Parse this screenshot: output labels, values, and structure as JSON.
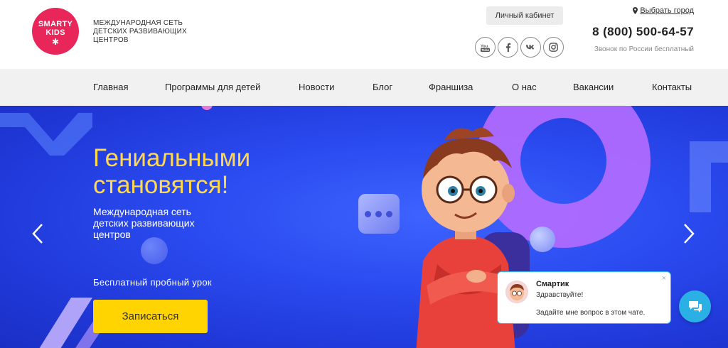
{
  "header": {
    "logo_line1": "SMARTY",
    "logo_line2": "KIDS",
    "tagline": "МЕЖДУНАРОДНАЯ СЕТЬ ДЕТСКИХ РАЗВИВАЮЩИХ ЦЕНТРОВ",
    "cabinet_label": "Личный кабинет",
    "city_label": "Выбрать город",
    "phone": "8 (800) 500-64-57",
    "phone_note": "Звонок по России бесплатный",
    "socials": [
      "youtube-icon",
      "facebook-icon",
      "vk-icon",
      "instagram-icon"
    ]
  },
  "nav": {
    "items": [
      "Главная",
      "Программы для детей",
      "Новости",
      "Блог",
      "Франшиза",
      "О нас",
      "Вакансии",
      "Контакты"
    ]
  },
  "hero": {
    "title_line1": "Гениальными",
    "title_line2": "становятся!",
    "subtitle": "Международная сеть детских развивающих центров",
    "lesson_label": "Бесплатный пробный урок",
    "signup_label": "Записаться"
  },
  "chat": {
    "name": "Смартик",
    "greeting": "Здравствуйте!",
    "prompt": "Задайте мне вопрос в этом чате.",
    "close": "×"
  },
  "colors": {
    "brand_pink": "#e8265a",
    "hero_blue": "#2a4bf0",
    "title_yellow": "#ffd84d",
    "button_yellow": "#ffd400",
    "chat_blue": "#2bb0e6"
  }
}
